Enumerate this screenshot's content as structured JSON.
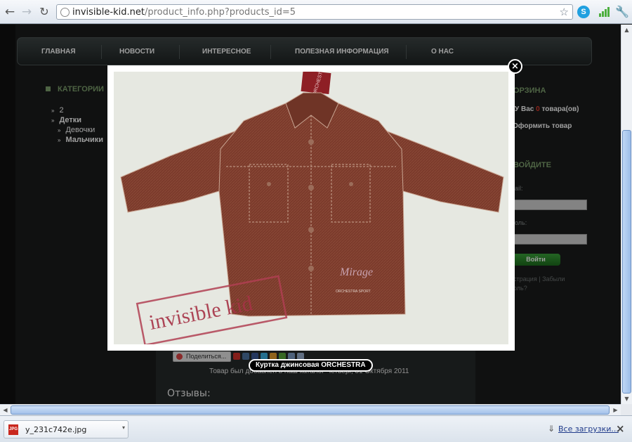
{
  "browser": {
    "url_host": "invisible-kid.net",
    "url_path": "/product_info.php?products_id=5",
    "back_icon": "←",
    "forward_icon": "→",
    "reload_icon": "↻",
    "star_icon": "☆",
    "skype_icon": "S",
    "wrench_icon": "🔧"
  },
  "menu": {
    "items": [
      "ГЛАВНАЯ",
      "НОВОСТИ",
      "ИНТЕРЕСНОЕ",
      "ПОЛЕЗНАЯ ИНФОРМАЦИЯ",
      "О НАС"
    ]
  },
  "categories": {
    "title": "КАТЕГОРИИ",
    "items": [
      {
        "label": "2"
      },
      {
        "label": "Детки"
      },
      {
        "label": "Девочки"
      },
      {
        "label": "Мальчики"
      }
    ]
  },
  "cart": {
    "title": "ОРЗИНА",
    "text_before": "У Вас ",
    "count": "0",
    "text_after": " товара(ов)",
    "checkout": "Оформить товар"
  },
  "login": {
    "title": "ВОЙДИТЕ",
    "email_label": "ail:",
    "password_label": "оль:",
    "button": "Войти",
    "register_link": "страция",
    "separator": "|",
    "forgot_link_1": "Забыли",
    "forgot_link_2": "оль?"
  },
  "product": {
    "share_label": "Поделиться...",
    "added_text": "Товар был добавлен в наш каталог Четверг, 31 Октября 2011",
    "reviews_title": "Отзывы:"
  },
  "lightbox": {
    "caption": "Куртка джинсовая ORCHESTRA",
    "close_icon": "×",
    "watermark": "invisible kid",
    "embroidery": "Mirage",
    "pocket_text": "ORCHESTRA SPORT",
    "tag_text": "ORCHESTRA"
  },
  "downloads": {
    "file_icon": "JPG",
    "file_name": "y_231c742e.jpg",
    "dropdown_icon": "▾",
    "show_all_icon": "⇓",
    "show_all": "Все загрузки...",
    "close_icon": "×"
  },
  "scrollbars": {
    "up_icon": "▲",
    "down_icon": "▼",
    "left_icon": "◀",
    "right_icon": "▶"
  },
  "colors": {
    "jacket": "#7b3a2b",
    "accent_green": "#7fa26f",
    "cart_count": "#e23b2c"
  }
}
